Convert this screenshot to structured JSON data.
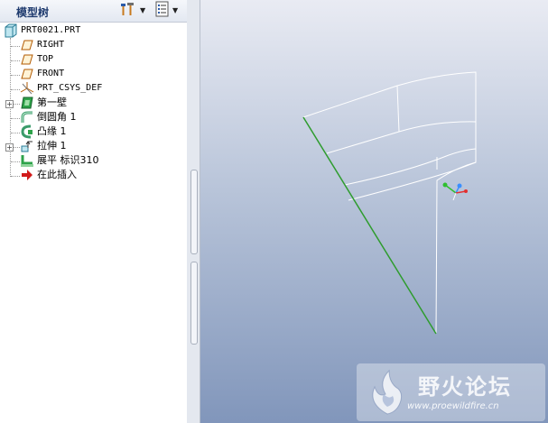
{
  "panel": {
    "title": "模型树"
  },
  "tree": {
    "root": "PRT0021.PRT",
    "items": [
      {
        "label": "RIGHT",
        "icon": "datum-plane-icon"
      },
      {
        "label": "TOP",
        "icon": "datum-plane-icon"
      },
      {
        "label": "FRONT",
        "icon": "datum-plane-icon"
      },
      {
        "label": "PRT_CSYS_DEF",
        "icon": "coordinate-system-icon"
      },
      {
        "label": "第一壁",
        "icon": "first-wall-icon"
      },
      {
        "label": "倒圆角 1",
        "icon": "round-icon"
      },
      {
        "label": "凸缘 1",
        "icon": "flange-icon"
      },
      {
        "label": "拉伸 1",
        "icon": "extrude-icon"
      },
      {
        "label": "展平 标识310",
        "icon": "unbend-icon"
      },
      {
        "label": "在此插入",
        "icon": "insert-here-arrow-icon"
      }
    ]
  },
  "watermark": {
    "title": "野火论坛",
    "url": "www.proewildfire.cn"
  },
  "colors": {
    "wireframe": "#ffffff",
    "selected_edge": "#2e9c2e",
    "insert_arrow": "#d11a1a"
  }
}
